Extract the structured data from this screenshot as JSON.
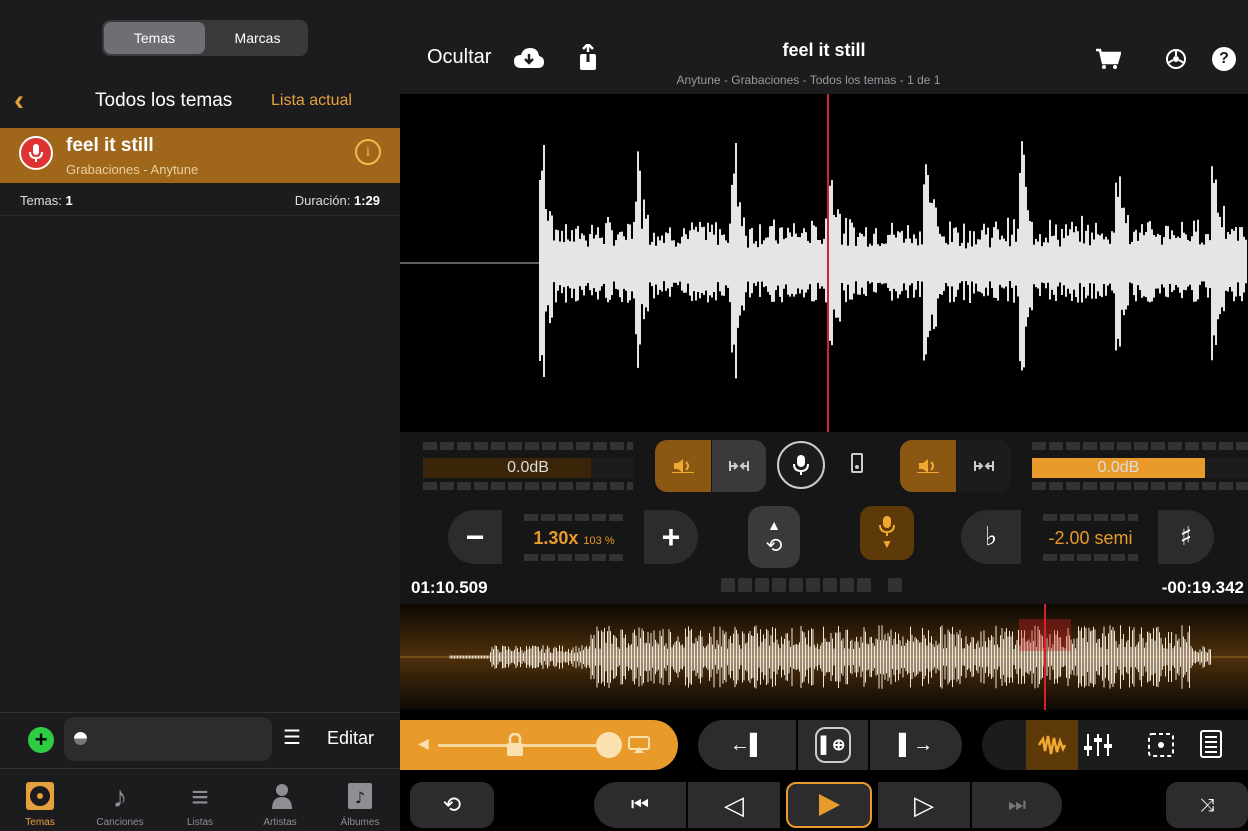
{
  "sidebar": {
    "segments": [
      "Temas",
      "Marcas"
    ],
    "nav_title": "Todos los temas",
    "nav_right": "Lista actual",
    "song": {
      "title": "feel it still",
      "subtitle": "Grabaciones - Anytune"
    },
    "stats": {
      "count_label": "Temas:",
      "count": "1",
      "duration_label": "Duración:",
      "duration": "1:29"
    },
    "edit_label": "Editar",
    "tabs": [
      {
        "label": "Temas",
        "icon": "disc-icon"
      },
      {
        "label": "Canciones",
        "icon": "note-icon"
      },
      {
        "label": "Listas",
        "icon": "playlist-icon"
      },
      {
        "label": "Artistas",
        "icon": "artist-icon"
      },
      {
        "label": "Álbumes",
        "icon": "album-icon"
      }
    ]
  },
  "player": {
    "hide_label": "Ocultar",
    "title": "feel it still",
    "path": "Anytune - Grabaciones - Todos los temas - 1 de 1",
    "left_level": "0.0dB",
    "right_level": "0.0dB",
    "speed": "1.30x",
    "speed_pct": "103 %",
    "pitch": "-2.00 semi",
    "time_elapsed": "01:10.509",
    "time_remaining": "-00:19.342",
    "accent": "#e89a2b",
    "playhead_color": "#d8202a"
  }
}
